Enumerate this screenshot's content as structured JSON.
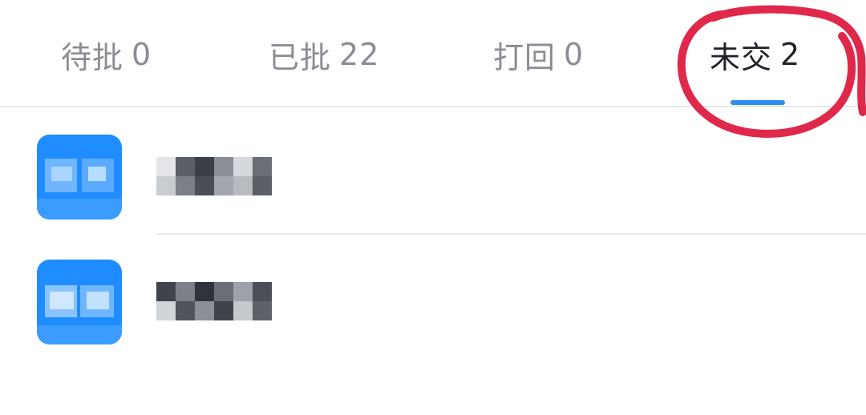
{
  "tabs": [
    {
      "label": "待批",
      "count": "0"
    },
    {
      "label": "已批",
      "count": "22"
    },
    {
      "label": "打回",
      "count": "0"
    },
    {
      "label": "未交",
      "count": "2"
    }
  ],
  "colors": {
    "accent": "#2b8ef5",
    "avatar": "#1f8cff",
    "annotation": "#e0284a",
    "text_active": "#1f2329",
    "text_inactive": "#8a8d93"
  },
  "icons": {
    "annotation": "hand-drawn-circle",
    "avatar": "blurred-avatar",
    "name": "blurred-name"
  }
}
